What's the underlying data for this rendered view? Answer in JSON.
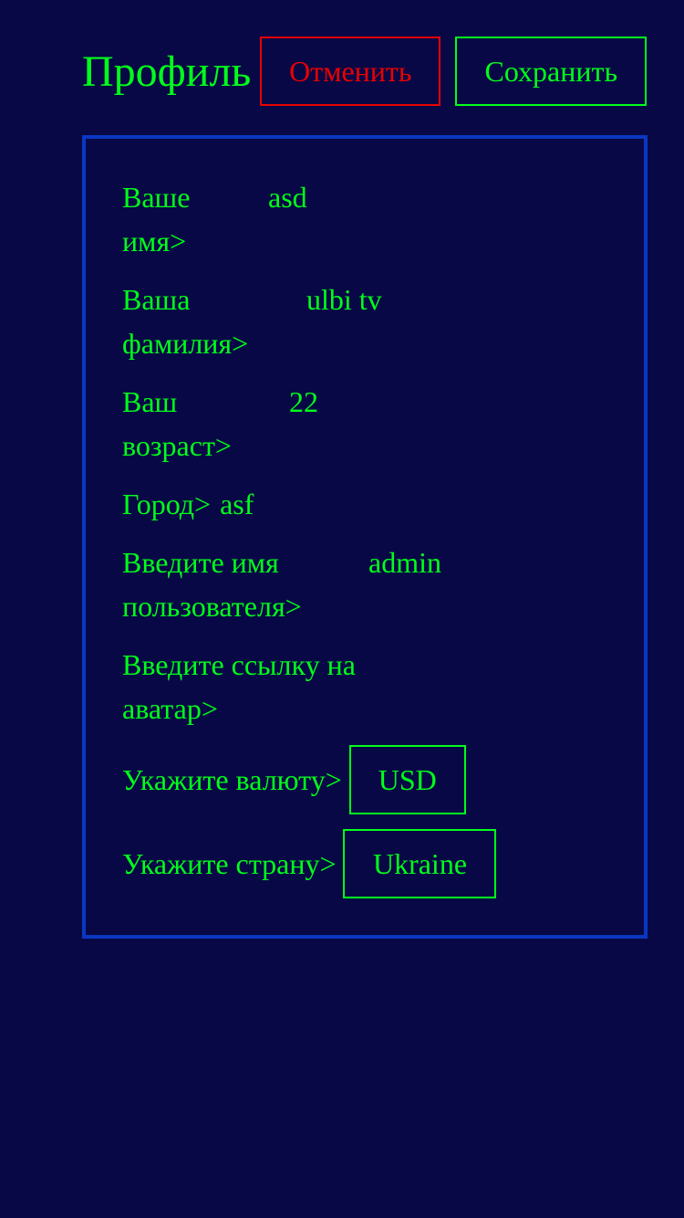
{
  "header": {
    "title": "Профиль",
    "cancel_label": "Отменить",
    "save_label": "Сохранить"
  },
  "form": {
    "first_name": {
      "label_line1": "Ваше",
      "label_line2": "имя>",
      "value": "asd"
    },
    "last_name": {
      "label_line1": "Ваша",
      "label_line2": "фамилия>",
      "value": "ulbi tv"
    },
    "age": {
      "label_line1": "Ваш",
      "label_line2": "возраст>",
      "value": "22"
    },
    "city": {
      "label": "Город>",
      "value": "asf"
    },
    "username": {
      "label_line1": "Введите имя",
      "label_line2": "пользователя>",
      "value": "admin"
    },
    "avatar": {
      "label_line1": "Введите ссылку на",
      "label_line2": "аватар>",
      "value": ""
    },
    "currency": {
      "label": "Укажите валюту>",
      "selected": "USD"
    },
    "country": {
      "label": "Укажите страну>",
      "selected": "Ukraine"
    }
  },
  "colors": {
    "background": "#090846",
    "text": "#00ff1a",
    "danger": "#e80000",
    "card_border": "#0a37c2"
  }
}
